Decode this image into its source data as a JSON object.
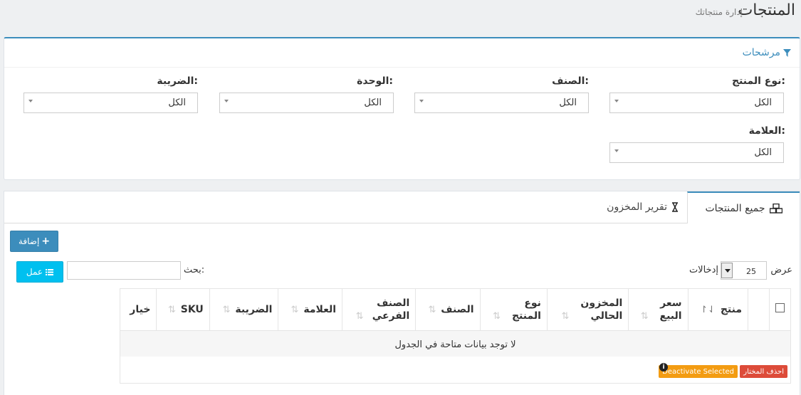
{
  "header": {
    "title": "المنتجات",
    "subtitle": "إدارة منتجاتك"
  },
  "filters": {
    "heading": "مرشحات",
    "fields": [
      {
        "label": "نوع المنتج:",
        "value": "الكل"
      },
      {
        "label": "الصنف:",
        "value": "الكل"
      },
      {
        "label": "الوحدة:",
        "value": "الكل"
      },
      {
        "label": "الضريبة:",
        "value": "الكل"
      },
      {
        "label": "العلامة:",
        "value": "الكل"
      }
    ]
  },
  "tabs": [
    {
      "label": "جميع المنتجات",
      "icon": "cubes-icon",
      "active": true
    },
    {
      "label": "تقرير المخزون",
      "icon": "hourglass-icon",
      "active": false
    }
  ],
  "toolbar": {
    "add_label": "إضافة",
    "columns_label": "عمل",
    "search_label": "بحث:",
    "length_prefix": "عرض",
    "length_value": "25",
    "length_suffix": "إدخالات"
  },
  "table": {
    "headers": [
      "منتج",
      "سعر البيع",
      "المخزون الحالي",
      "نوع المنتج",
      "الصنف",
      "الصنف الفرعي",
      "العلامة",
      "الضريبة",
      "SKU",
      "خيار"
    ],
    "empty_message": "لا توجد بيانات متاحة في الجدول"
  },
  "bulk": {
    "delete_label": "احذف المختار",
    "deactivate_label": "Deactivate Selected"
  },
  "colors": {
    "primary": "#3c8dbc",
    "info": "#00c0ef",
    "danger": "#dd4b39",
    "warning": "#f39c12"
  }
}
